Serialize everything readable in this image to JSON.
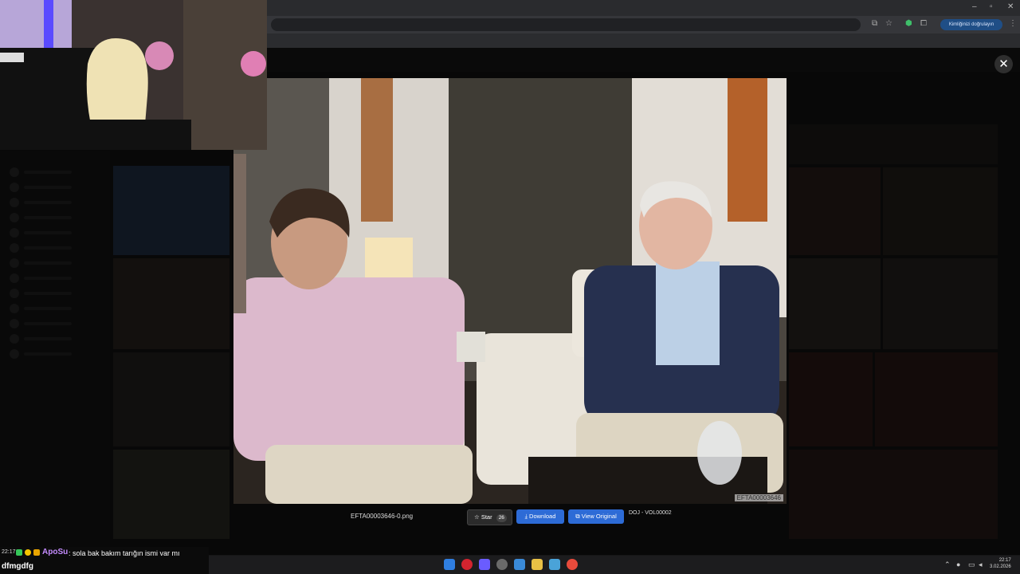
{
  "browser": {
    "verify_pill": "Kimliğinizi doğrulayın",
    "window_controls": [
      "–",
      "▫",
      "✕"
    ]
  },
  "viewer": {
    "close_label": "✕",
    "filename": "EFTA00003646-0.png",
    "photo_tag": "EFTA00003646",
    "star_label": "Star",
    "star_count": "26",
    "download_label": "Download",
    "view_original_label": "View Original",
    "doc_label": "DOJ - VOL00002"
  },
  "chat": {
    "time": "22:17",
    "username": "ApoSu",
    "message": ": sola bak bakım tarığın ismi var mı",
    "second_line": "dfmgdfg"
  },
  "taskbar": {
    "time": "22:17",
    "date": "3.02.2026"
  },
  "icons": {
    "close": "close-icon",
    "star": "star-icon",
    "download": "download-icon",
    "external": "external-link-icon"
  }
}
